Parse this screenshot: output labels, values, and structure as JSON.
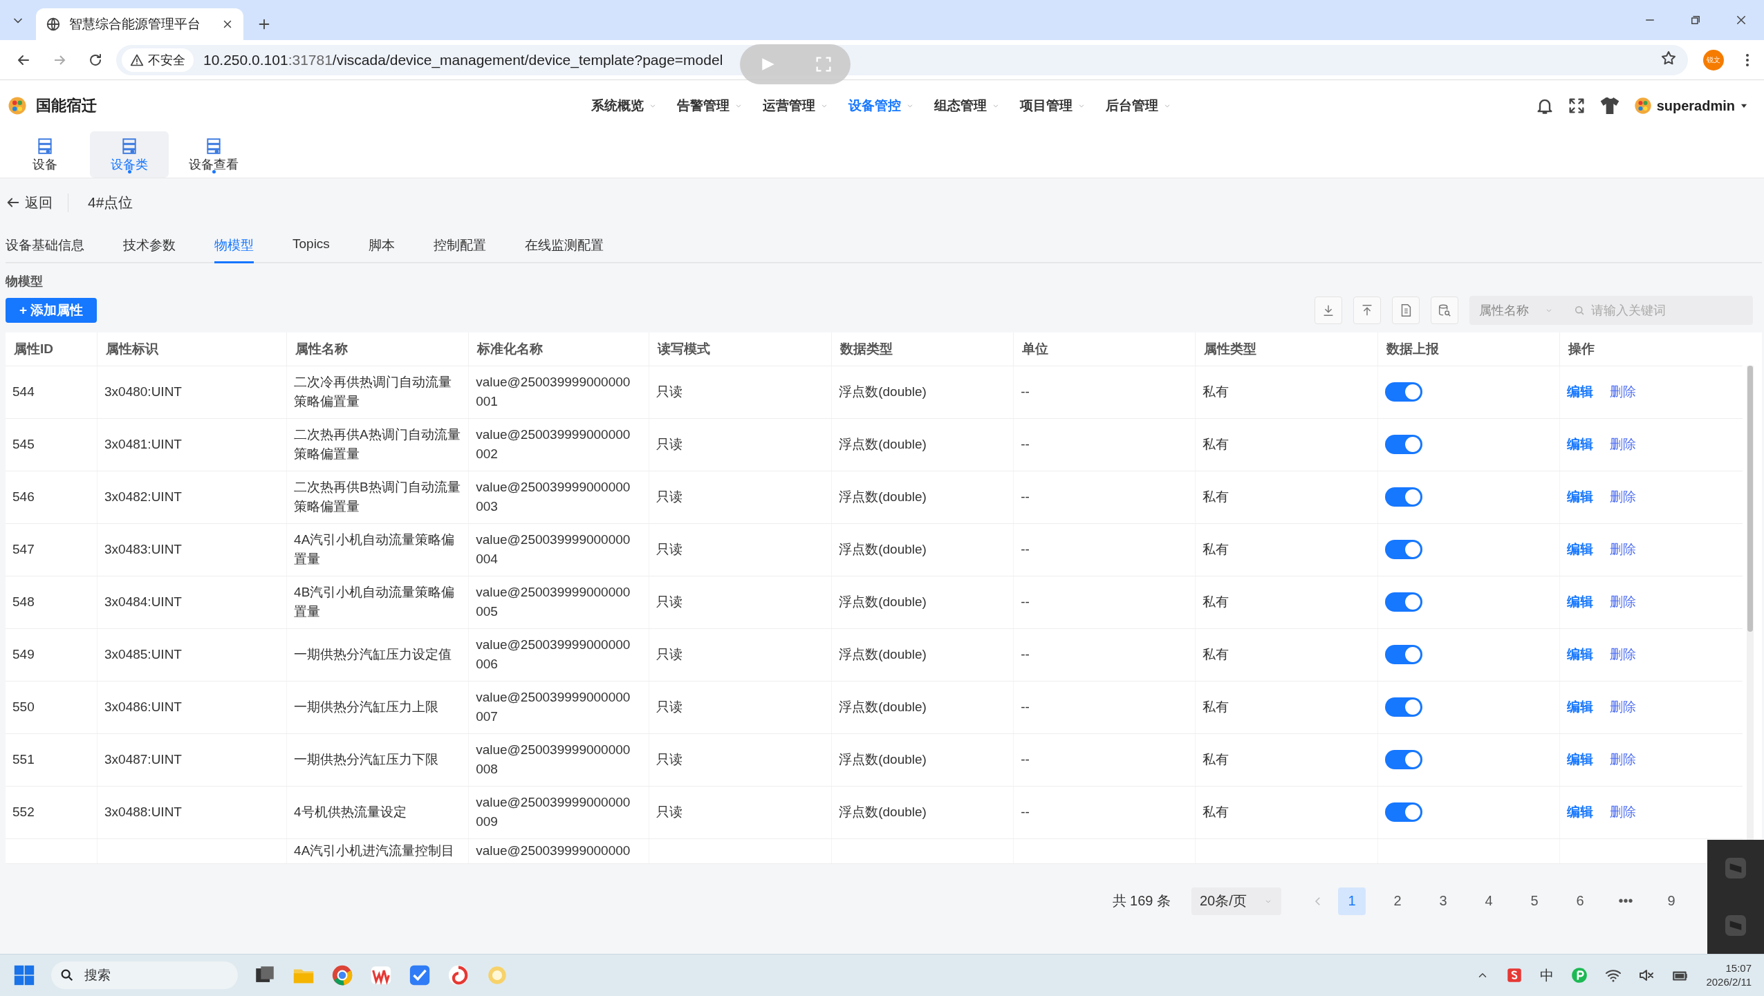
{
  "browser": {
    "tabs": [
      {
        "title": "智慧综合能源管理平台",
        "selected": true
      }
    ],
    "security": "不安全",
    "url_host": "10.250.0.101",
    "url_port": ":31781",
    "url_path": "/viscada/device_management/device_template?page=model",
    "profile": "锐文"
  },
  "app": {
    "brand": "国能宿迁",
    "nav": [
      {
        "label": "系统概览",
        "selected": false
      },
      {
        "label": "告警管理",
        "selected": false
      },
      {
        "label": "运营管理",
        "selected": false
      },
      {
        "label": "设备管控",
        "selected": true
      },
      {
        "label": "组态管理",
        "selected": false
      },
      {
        "label": "项目管理",
        "selected": false
      },
      {
        "label": "后台管理",
        "selected": false
      }
    ],
    "user": "superadmin"
  },
  "subnav": [
    {
      "label": "设备",
      "selected": false,
      "open": false
    },
    {
      "label": "设备类",
      "selected": true,
      "open": true
    },
    {
      "label": "设备查看",
      "selected": false,
      "open": true
    }
  ],
  "back": "返回",
  "page_title": "4#点位",
  "tabs": [
    {
      "label": "设备基础信息",
      "selected": false
    },
    {
      "label": "技术参数",
      "selected": false
    },
    {
      "label": "物模型",
      "selected": true
    },
    {
      "label": "Topics",
      "selected": false
    },
    {
      "label": "脚本",
      "selected": false
    },
    {
      "label": "控制配置",
      "selected": false
    },
    {
      "label": "在线监测配置",
      "selected": false
    }
  ],
  "section_title": "物模型",
  "add_button": "+ 添加属性",
  "filter": {
    "field": "属性名称",
    "placeholder": "请输入关键词"
  },
  "table": {
    "columns": [
      "属性ID",
      "属性标识",
      "属性名称",
      "标准化名称",
      "读写模式",
      "数据类型",
      "单位",
      "属性类型",
      "数据上报",
      "操作"
    ],
    "rows": [
      {
        "kind": "full",
        "id": "544",
        "key": "3x0480:UINT",
        "name": "二次冷再供热调门自动流量策略偏置量",
        "std": "value@250039999000000001",
        "mode": "只读",
        "dtype": "浮点数(double)",
        "unit": "--",
        "ptype": "私有",
        "report": true,
        "actions": [
          "编辑",
          "删除"
        ]
      },
      {
        "kind": "full",
        "id": "545",
        "key": "3x0481:UINT",
        "name": "二次热再供A热调门自动流量策略偏置量",
        "std": "value@250039999000000002",
        "mode": "只读",
        "dtype": "浮点数(double)",
        "unit": "--",
        "ptype": "私有",
        "report": true,
        "actions": [
          "编辑",
          "删除"
        ]
      },
      {
        "kind": "full",
        "id": "546",
        "key": "3x0482:UINT",
        "name": "二次热再供B热调门自动流量策略偏置量",
        "std": "value@250039999000000003",
        "mode": "只读",
        "dtype": "浮点数(double)",
        "unit": "--",
        "ptype": "私有",
        "report": true,
        "actions": [
          "编辑",
          "删除"
        ]
      },
      {
        "kind": "full",
        "id": "547",
        "key": "3x0483:UINT",
        "name": "4A汽引小机自动流量策略偏置量",
        "std": "value@250039999000000004",
        "mode": "只读",
        "dtype": "浮点数(double)",
        "unit": "--",
        "ptype": "私有",
        "report": true,
        "actions": [
          "编辑",
          "删除"
        ]
      },
      {
        "kind": "full",
        "id": "548",
        "key": "3x0484:UINT",
        "name": "4B汽引小机自动流量策略偏置量",
        "std": "value@250039999000000005",
        "mode": "只读",
        "dtype": "浮点数(double)",
        "unit": "--",
        "ptype": "私有",
        "report": true,
        "actions": [
          "编辑",
          "删除"
        ]
      },
      {
        "kind": "full",
        "id": "549",
        "key": "3x0485:UINT",
        "name": "一期供热分汽缸压力设定值",
        "std": "value@250039999000000006",
        "mode": "只读",
        "dtype": "浮点数(double)",
        "unit": "--",
        "ptype": "私有",
        "report": true,
        "actions": [
          "编辑",
          "删除"
        ]
      },
      {
        "kind": "full",
        "id": "550",
        "key": "3x0486:UINT",
        "name": "一期供热分汽缸压力上限",
        "std": "value@250039999000000007",
        "mode": "只读",
        "dtype": "浮点数(double)",
        "unit": "--",
        "ptype": "私有",
        "report": true,
        "actions": [
          "编辑",
          "删除"
        ]
      },
      {
        "kind": "full",
        "id": "551",
        "key": "3x0487:UINT",
        "name": "一期供热分汽缸压力下限",
        "std": "value@250039999000000008",
        "mode": "只读",
        "dtype": "浮点数(double)",
        "unit": "--",
        "ptype": "私有",
        "report": true,
        "actions": [
          "编辑",
          "删除"
        ]
      },
      {
        "kind": "full",
        "id": "552",
        "key": "3x0488:UINT",
        "name": "4号机供热流量设定",
        "std": "value@250039999000000009",
        "mode": "只读",
        "dtype": "浮点数(double)",
        "unit": "--",
        "ptype": "私有",
        "report": true,
        "actions": [
          "编辑",
          "删除"
        ]
      },
      {
        "kind": "partial",
        "name": "4A汽引小机进汽流量控制目",
        "std": "value@250039999000000"
      }
    ]
  },
  "pagination": {
    "total": "共 169 条",
    "page_size": "20条/页",
    "pages": [
      {
        "label": "1",
        "selected": true
      },
      {
        "label": "2",
        "selected": false
      },
      {
        "label": "3",
        "selected": false
      },
      {
        "label": "4",
        "selected": false
      },
      {
        "label": "5",
        "selected": false
      },
      {
        "label": "6",
        "selected": false
      },
      {
        "label": "•••",
        "selected": false
      },
      {
        "label": "9",
        "selected": false
      }
    ]
  },
  "taskbar": {
    "search": "搜索",
    "ime": "中",
    "time": "15:07",
    "date": "2026/2/11"
  }
}
